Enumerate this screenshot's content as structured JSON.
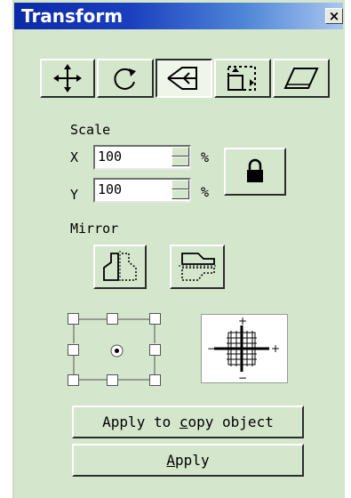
{
  "window": {
    "title": "Transform",
    "close_glyph": "✕"
  },
  "toolbar": {
    "tools": [
      {
        "name": "move",
        "icon": "move-arrows-icon",
        "active": false
      },
      {
        "name": "rotate",
        "icon": "rotate-icon",
        "active": false
      },
      {
        "name": "scale",
        "icon": "scale-icon",
        "active": true
      },
      {
        "name": "size",
        "icon": "size-icon",
        "active": false
      },
      {
        "name": "skew",
        "icon": "skew-icon",
        "active": false
      }
    ]
  },
  "scale": {
    "heading": "Scale",
    "x_label": "X",
    "x_value": "100",
    "x_unit": "%",
    "y_label": "Y",
    "y_value": "100",
    "y_unit": "%",
    "lock_icon": "lock-icon"
  },
  "mirror": {
    "heading": "Mirror",
    "buttons": [
      "mirror-horizontal-icon",
      "mirror-vertical-icon"
    ]
  },
  "anchor": {
    "selected": "center"
  },
  "buttons": {
    "apply_copy_pre": "Apply to ",
    "apply_copy_key": "c",
    "apply_copy_post": "opy object",
    "apply_key": "A",
    "apply_rest": "pply"
  },
  "colors": {
    "panel": "#d4e6cc",
    "titlebar": "#0b2aa8"
  }
}
